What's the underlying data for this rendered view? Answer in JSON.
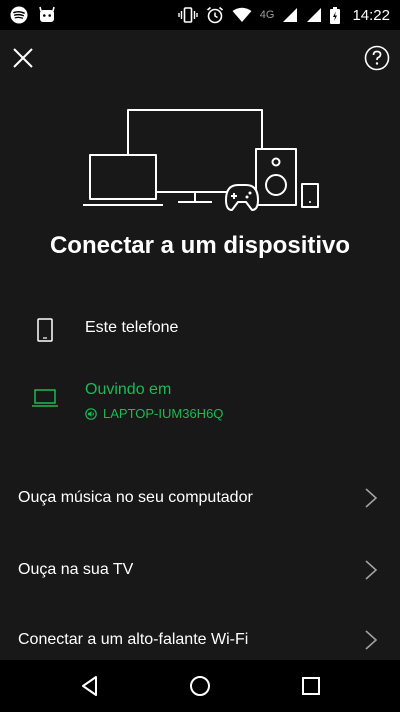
{
  "status_bar": {
    "time": "14:22",
    "network": "4G",
    "left_icons": [
      "spotify-icon",
      "android-notification-icon"
    ],
    "right_icons": [
      "vibrate-icon",
      "alarm-icon",
      "wifi-icon",
      "signal-icon",
      "battery-icon"
    ]
  },
  "header": {
    "close_icon": "close-icon",
    "help_icon": "help-icon"
  },
  "title": "Conectar a um dispositivo",
  "devices": [
    {
      "icon": "phone-icon",
      "name": "Este telefone"
    },
    {
      "icon": "laptop-icon",
      "name": "Ouvindo em",
      "sub": "LAPTOP-IUM36H6Q",
      "active": true
    }
  ],
  "options": [
    {
      "label": "Ouça música no seu computador"
    },
    {
      "label": "Ouça na sua TV"
    },
    {
      "label": "Conectar a um alto-falante Wi-Fi"
    }
  ],
  "colors": {
    "background": "#181818",
    "accent_green": "#1db954",
    "nav_background": "#000000"
  },
  "nav": [
    "back-icon",
    "home-icon",
    "recents-icon"
  ]
}
